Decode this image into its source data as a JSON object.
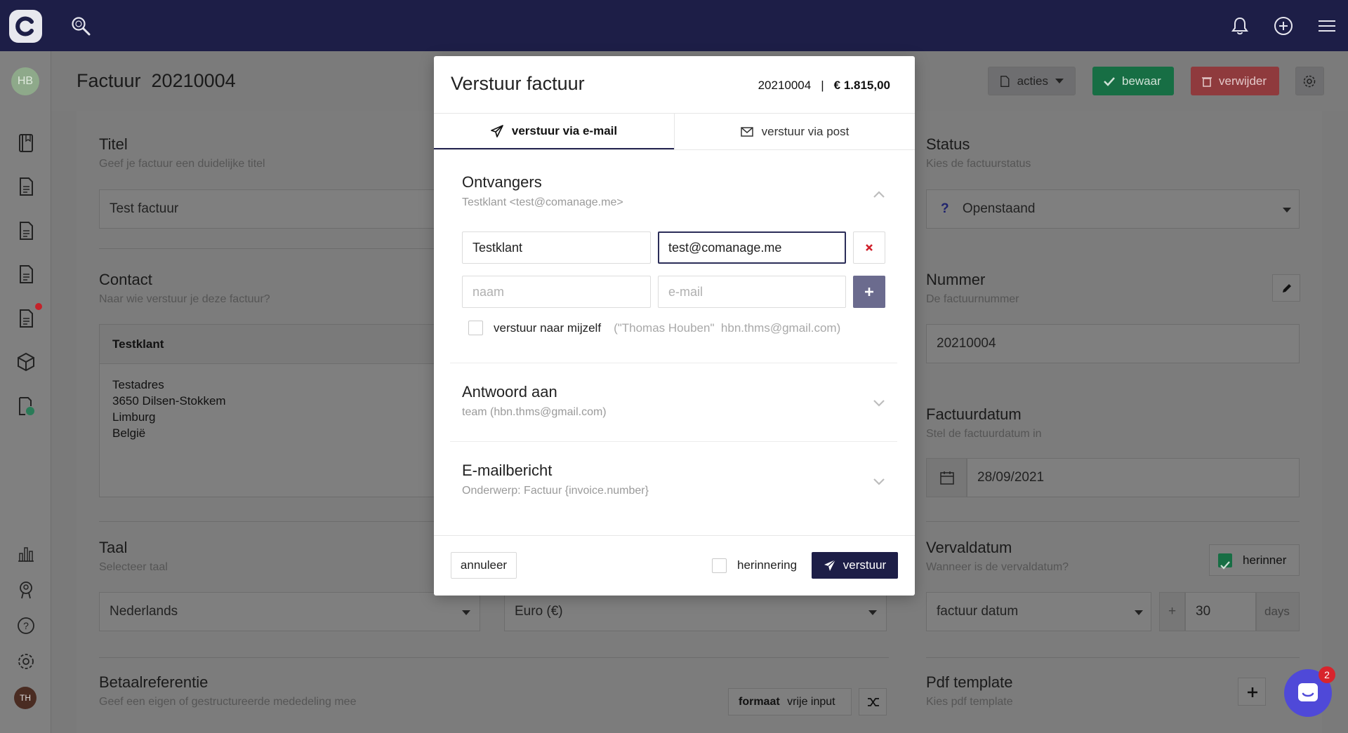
{
  "topbar": {
    "logo_letter": "C"
  },
  "sidebar": {
    "avatar": "HB",
    "user": "TH"
  },
  "header": {
    "title": "Factuur  20210004",
    "acties": "acties",
    "bewaar": "bewaar",
    "verwijder": "verwijder"
  },
  "form": {
    "titel": {
      "label": "Titel",
      "sub": "Geef je factuur een duidelijke titel",
      "value": "Test factuur"
    },
    "contact": {
      "label": "Contact",
      "sub": "Naar wie verstuur je deze factuur?",
      "name": "Testklant",
      "address": [
        "Testadres",
        "3650 Dilsen-Stokkem",
        "Limburg",
        "België"
      ]
    },
    "taal": {
      "label": "Taal",
      "sub": "Selecteer taal",
      "value": "Nederlands"
    },
    "munt": {
      "value": "Euro (€)"
    },
    "betaalreferentie": {
      "label": "Betaalreferentie",
      "sub": "Geef een eigen of gestructureerde mededeling mee",
      "formaat_label": "formaat",
      "formaat_value": "vrije input"
    },
    "status": {
      "label": "Status",
      "sub": "Kies de factuurstatus",
      "value": "Openstaand",
      "icon_char": "?"
    },
    "nummer": {
      "label": "Nummer",
      "sub": "De factuurnummer",
      "value": "20210004"
    },
    "factuurdatum": {
      "label": "Factuurdatum",
      "sub": "Stel de factuurdatum in",
      "value": "28/09/2021"
    },
    "vervaldatum": {
      "label": "Vervaldatum",
      "sub": "Wanneer is de vervaldatum?",
      "herinner": "herinner",
      "basis": "factuur datum",
      "plus": "+",
      "days_value": "30",
      "days_label": "days"
    },
    "pdf": {
      "label": "Pdf template",
      "sub": "Kies pdf template"
    }
  },
  "modal": {
    "title": "Verstuur factuur",
    "number": "20210004",
    "separator": "|",
    "amount": "€ 1.815,00",
    "tabs": [
      {
        "label": "verstuur via e-mail",
        "icon": "paper-plane-icon",
        "active": true
      },
      {
        "label": "verstuur via post",
        "icon": "envelope-icon",
        "active": false
      }
    ],
    "ontvangers": {
      "title": "Ontvangers",
      "sub": "Testklant <test@comanage.me>",
      "recipient_name": "Testklant",
      "recipient_email": "test@comanage.me",
      "name_placeholder": "naam",
      "email_placeholder": "e-mail",
      "self_label": "verstuur naar mijzelf",
      "self_detail": "(\"Thomas Houben\"  hbn.thms@gmail.com)"
    },
    "antwoord": {
      "title": "Antwoord aan",
      "sub": "team (hbn.thms@gmail.com)"
    },
    "emailbericht": {
      "title": "E-mailbericht",
      "sub": "Onderwerp: Factuur {invoice.number}"
    },
    "footer": {
      "annuleer": "annuleer",
      "herinnering": "herinnering",
      "verstuur": "verstuur"
    }
  },
  "chat": {
    "badge": "2"
  },
  "colors": {
    "navy": "#1d1e47",
    "green": "#176e44",
    "red": "#8f3a3d",
    "chat": "#4f49d8"
  }
}
